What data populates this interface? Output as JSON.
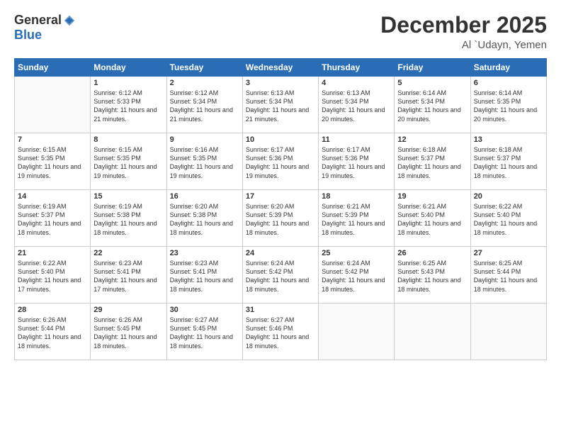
{
  "logo": {
    "general": "General",
    "blue": "Blue"
  },
  "header": {
    "month": "December 2025",
    "location": "Al `Udayn, Yemen"
  },
  "weekdays": [
    "Sunday",
    "Monday",
    "Tuesday",
    "Wednesday",
    "Thursday",
    "Friday",
    "Saturday"
  ],
  "weeks": [
    [
      {
        "day": "",
        "sunrise": "",
        "sunset": "",
        "daylight": ""
      },
      {
        "day": "1",
        "sunrise": "Sunrise: 6:12 AM",
        "sunset": "Sunset: 5:33 PM",
        "daylight": "Daylight: 11 hours and 21 minutes."
      },
      {
        "day": "2",
        "sunrise": "Sunrise: 6:12 AM",
        "sunset": "Sunset: 5:34 PM",
        "daylight": "Daylight: 11 hours and 21 minutes."
      },
      {
        "day": "3",
        "sunrise": "Sunrise: 6:13 AM",
        "sunset": "Sunset: 5:34 PM",
        "daylight": "Daylight: 11 hours and 21 minutes."
      },
      {
        "day": "4",
        "sunrise": "Sunrise: 6:13 AM",
        "sunset": "Sunset: 5:34 PM",
        "daylight": "Daylight: 11 hours and 20 minutes."
      },
      {
        "day": "5",
        "sunrise": "Sunrise: 6:14 AM",
        "sunset": "Sunset: 5:34 PM",
        "daylight": "Daylight: 11 hours and 20 minutes."
      },
      {
        "day": "6",
        "sunrise": "Sunrise: 6:14 AM",
        "sunset": "Sunset: 5:35 PM",
        "daylight": "Daylight: 11 hours and 20 minutes."
      }
    ],
    [
      {
        "day": "7",
        "sunrise": "Sunrise: 6:15 AM",
        "sunset": "Sunset: 5:35 PM",
        "daylight": "Daylight: 11 hours and 19 minutes."
      },
      {
        "day": "8",
        "sunrise": "Sunrise: 6:15 AM",
        "sunset": "Sunset: 5:35 PM",
        "daylight": "Daylight: 11 hours and 19 minutes."
      },
      {
        "day": "9",
        "sunrise": "Sunrise: 6:16 AM",
        "sunset": "Sunset: 5:35 PM",
        "daylight": "Daylight: 11 hours and 19 minutes."
      },
      {
        "day": "10",
        "sunrise": "Sunrise: 6:17 AM",
        "sunset": "Sunset: 5:36 PM",
        "daylight": "Daylight: 11 hours and 19 minutes."
      },
      {
        "day": "11",
        "sunrise": "Sunrise: 6:17 AM",
        "sunset": "Sunset: 5:36 PM",
        "daylight": "Daylight: 11 hours and 19 minutes."
      },
      {
        "day": "12",
        "sunrise": "Sunrise: 6:18 AM",
        "sunset": "Sunset: 5:37 PM",
        "daylight": "Daylight: 11 hours and 18 minutes."
      },
      {
        "day": "13",
        "sunrise": "Sunrise: 6:18 AM",
        "sunset": "Sunset: 5:37 PM",
        "daylight": "Daylight: 11 hours and 18 minutes."
      }
    ],
    [
      {
        "day": "14",
        "sunrise": "Sunrise: 6:19 AM",
        "sunset": "Sunset: 5:37 PM",
        "daylight": "Daylight: 11 hours and 18 minutes."
      },
      {
        "day": "15",
        "sunrise": "Sunrise: 6:19 AM",
        "sunset": "Sunset: 5:38 PM",
        "daylight": "Daylight: 11 hours and 18 minutes."
      },
      {
        "day": "16",
        "sunrise": "Sunrise: 6:20 AM",
        "sunset": "Sunset: 5:38 PM",
        "daylight": "Daylight: 11 hours and 18 minutes."
      },
      {
        "day": "17",
        "sunrise": "Sunrise: 6:20 AM",
        "sunset": "Sunset: 5:39 PM",
        "daylight": "Daylight: 11 hours and 18 minutes."
      },
      {
        "day": "18",
        "sunrise": "Sunrise: 6:21 AM",
        "sunset": "Sunset: 5:39 PM",
        "daylight": "Daylight: 11 hours and 18 minutes."
      },
      {
        "day": "19",
        "sunrise": "Sunrise: 6:21 AM",
        "sunset": "Sunset: 5:40 PM",
        "daylight": "Daylight: 11 hours and 18 minutes."
      },
      {
        "day": "20",
        "sunrise": "Sunrise: 6:22 AM",
        "sunset": "Sunset: 5:40 PM",
        "daylight": "Daylight: 11 hours and 18 minutes."
      }
    ],
    [
      {
        "day": "21",
        "sunrise": "Sunrise: 6:22 AM",
        "sunset": "Sunset: 5:40 PM",
        "daylight": "Daylight: 11 hours and 17 minutes."
      },
      {
        "day": "22",
        "sunrise": "Sunrise: 6:23 AM",
        "sunset": "Sunset: 5:41 PM",
        "daylight": "Daylight: 11 hours and 17 minutes."
      },
      {
        "day": "23",
        "sunrise": "Sunrise: 6:23 AM",
        "sunset": "Sunset: 5:41 PM",
        "daylight": "Daylight: 11 hours and 18 minutes."
      },
      {
        "day": "24",
        "sunrise": "Sunrise: 6:24 AM",
        "sunset": "Sunset: 5:42 PM",
        "daylight": "Daylight: 11 hours and 18 minutes."
      },
      {
        "day": "25",
        "sunrise": "Sunrise: 6:24 AM",
        "sunset": "Sunset: 5:42 PM",
        "daylight": "Daylight: 11 hours and 18 minutes."
      },
      {
        "day": "26",
        "sunrise": "Sunrise: 6:25 AM",
        "sunset": "Sunset: 5:43 PM",
        "daylight": "Daylight: 11 hours and 18 minutes."
      },
      {
        "day": "27",
        "sunrise": "Sunrise: 6:25 AM",
        "sunset": "Sunset: 5:44 PM",
        "daylight": "Daylight: 11 hours and 18 minutes."
      }
    ],
    [
      {
        "day": "28",
        "sunrise": "Sunrise: 6:26 AM",
        "sunset": "Sunset: 5:44 PM",
        "daylight": "Daylight: 11 hours and 18 minutes."
      },
      {
        "day": "29",
        "sunrise": "Sunrise: 6:26 AM",
        "sunset": "Sunset: 5:45 PM",
        "daylight": "Daylight: 11 hours and 18 minutes."
      },
      {
        "day": "30",
        "sunrise": "Sunrise: 6:27 AM",
        "sunset": "Sunset: 5:45 PM",
        "daylight": "Daylight: 11 hours and 18 minutes."
      },
      {
        "day": "31",
        "sunrise": "Sunrise: 6:27 AM",
        "sunset": "Sunset: 5:46 PM",
        "daylight": "Daylight: 11 hours and 18 minutes."
      },
      {
        "day": "",
        "sunrise": "",
        "sunset": "",
        "daylight": ""
      },
      {
        "day": "",
        "sunrise": "",
        "sunset": "",
        "daylight": ""
      },
      {
        "day": "",
        "sunrise": "",
        "sunset": "",
        "daylight": ""
      }
    ]
  ]
}
